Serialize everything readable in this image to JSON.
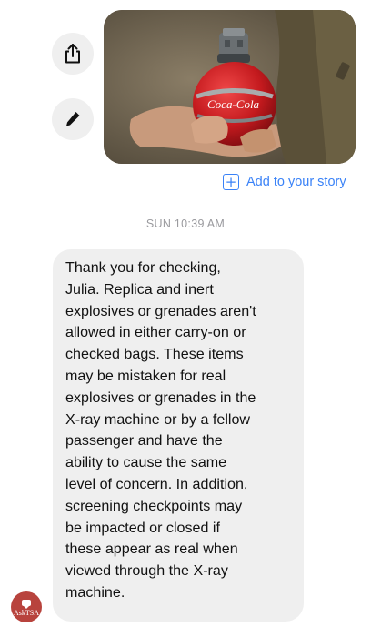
{
  "actions": {
    "share_icon": "share-icon",
    "edit_icon": "pencil-icon"
  },
  "photo": {
    "bottle_text": "Coca-Cola"
  },
  "story": {
    "icon": "add-square-icon",
    "label": "Add to your story"
  },
  "conversation": {
    "timestamp": "SUN 10:39 AM",
    "message": "Thank you for checking,\nJulia. Replica and inert\nexplosives or grenades aren't\nallowed in either carry-on or\nchecked bags. These items\nmay be mistaken for real\nexplosives or grenades in the\nX-ray machine or by a fellow\npassenger and have the\nability to cause the same\nlevel of concern. In addition,\nscreening checkpoints may\nbe impacted or closed if\nthese appear as real when\nviewed through the X-ray\nmachine.",
    "sender_avatar_label": "AskTSA"
  },
  "colors": {
    "accent": "#3a82f7",
    "bubble": "#efefef",
    "avatar": "#b8433d"
  }
}
